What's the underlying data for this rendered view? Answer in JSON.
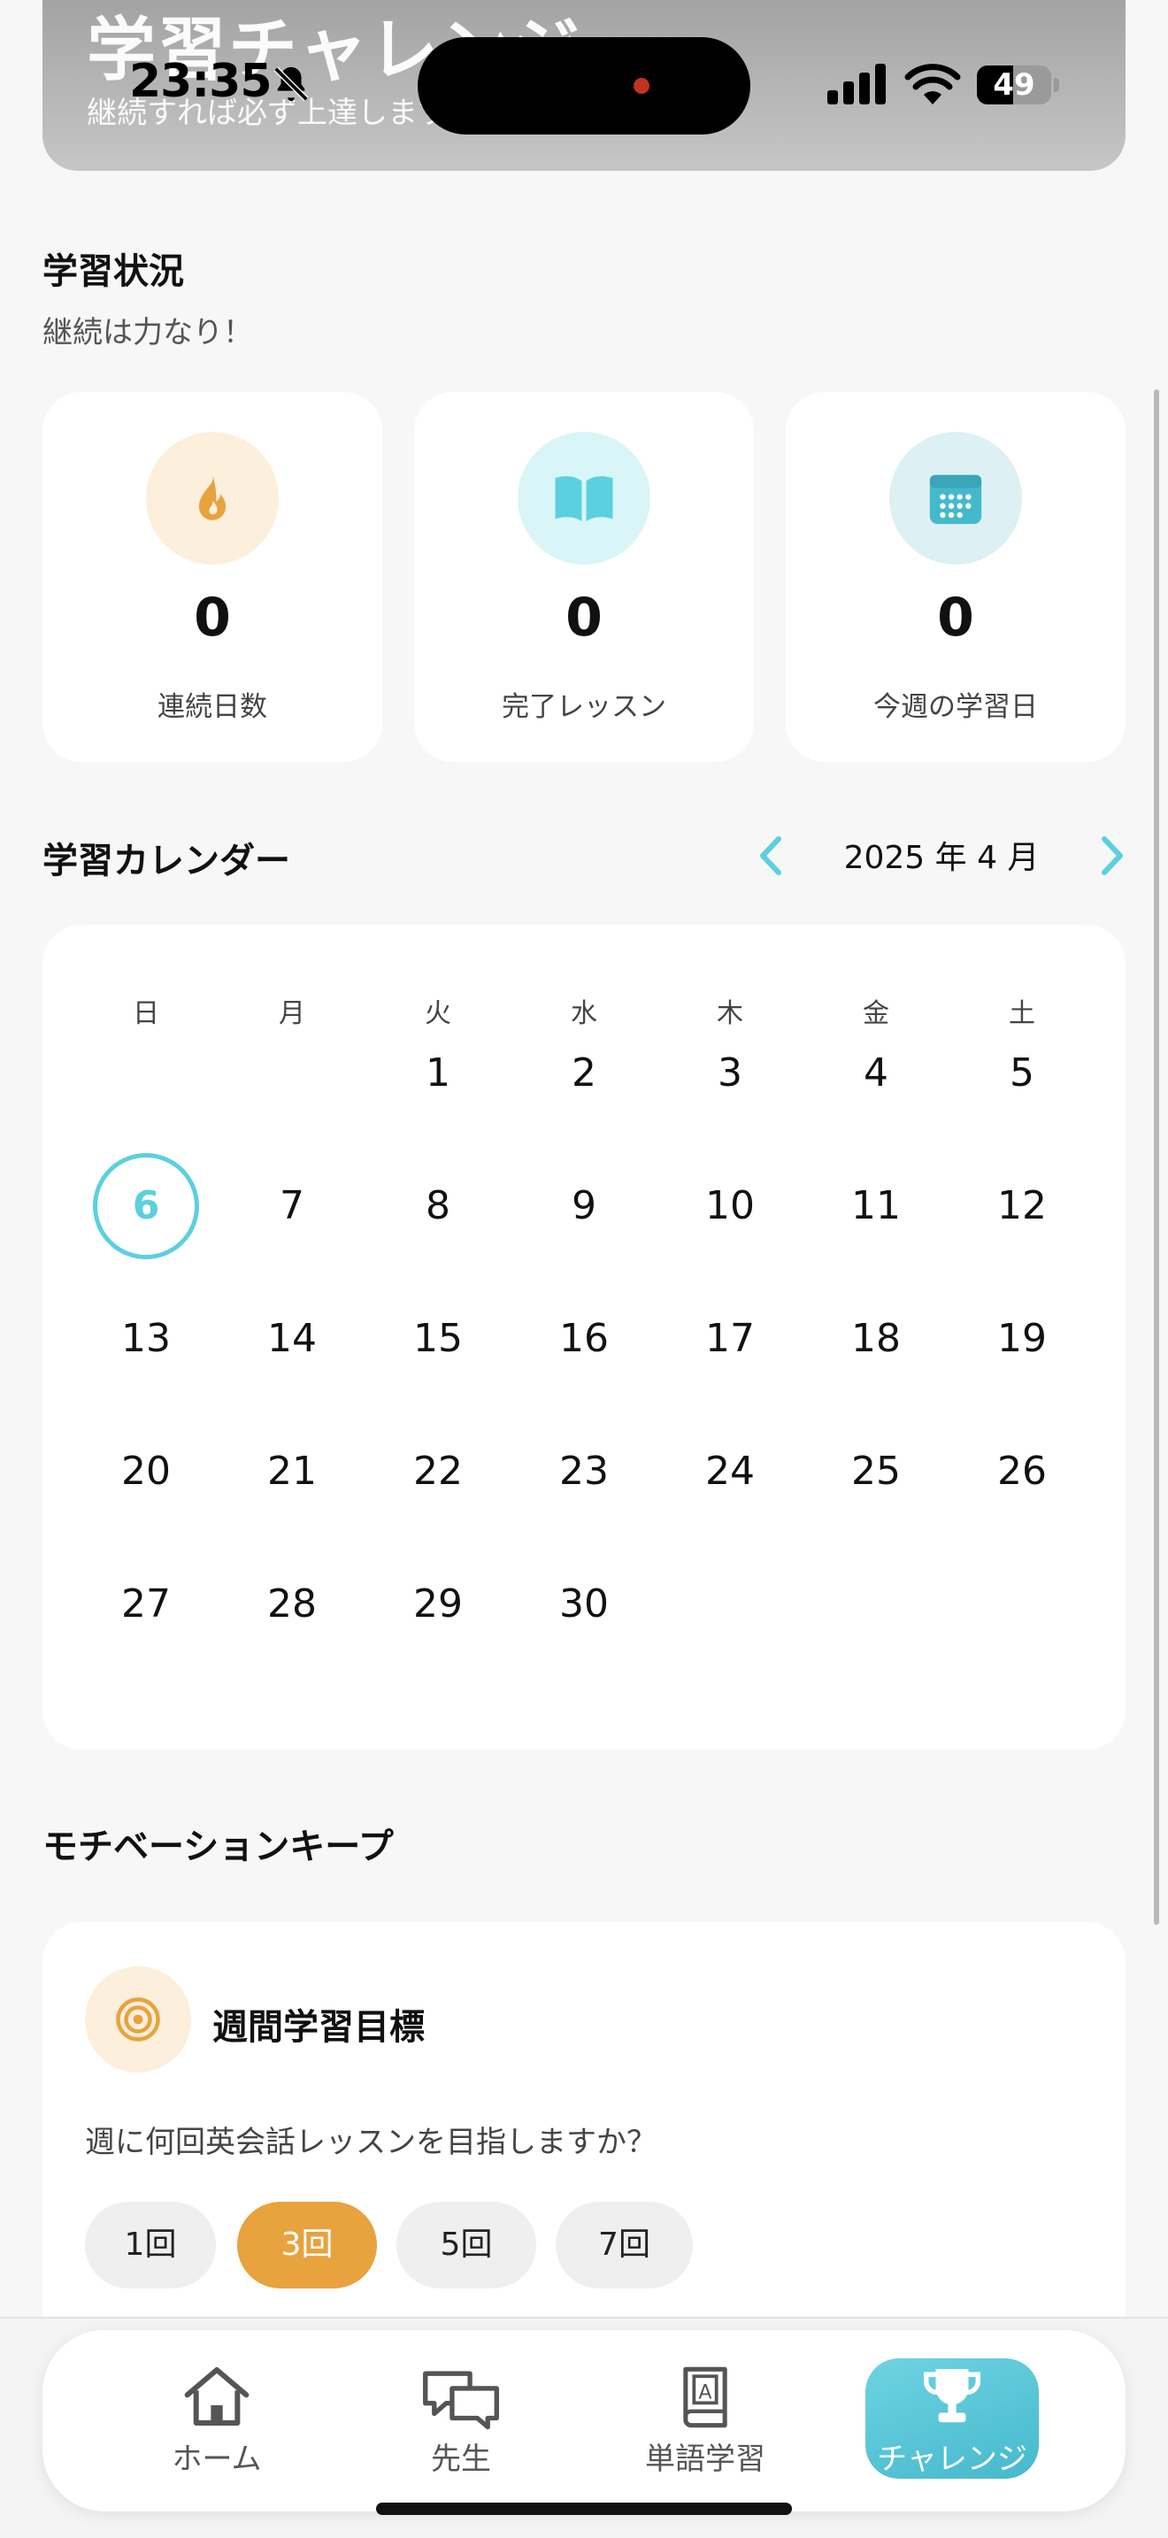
{
  "banner": {
    "title": "学習チャレンジ",
    "subtitle": "継続すれば必ず上達します"
  },
  "status_bar": {
    "time": "23:35",
    "battery_level": "49",
    "battery_fraction": 0.49,
    "icons": [
      "bell-slash-icon",
      "signal-icon",
      "wifi-icon",
      "battery-icon"
    ]
  },
  "study_status": {
    "title": "学習状況",
    "subtitle": "継続は力なり！",
    "stats": [
      {
        "value": "0",
        "label": "連続日数",
        "icon": "flame-icon",
        "icon_bg": "#fcefdc",
        "icon_color": "#e8a23e"
      },
      {
        "value": "0",
        "label": "完了レッスン",
        "icon": "book-icon",
        "icon_bg": "#d9f5f8",
        "icon_color": "#5bd0df"
      },
      {
        "value": "0",
        "label": "今週の学習日",
        "icon": "calendar-icon",
        "icon_bg": "#ddf0f4",
        "icon_color": "#45b9cc"
      }
    ]
  },
  "calendar": {
    "title": "学習カレンダー",
    "month_label": "2025 年 4 月",
    "weekdays": [
      "日",
      "月",
      "火",
      "水",
      "木",
      "金",
      "土"
    ],
    "weeks": [
      [
        "",
        "",
        "1",
        "2",
        "3",
        "4",
        "5"
      ],
      [
        "6",
        "7",
        "8",
        "9",
        "10",
        "11",
        "12"
      ],
      [
        "13",
        "14",
        "15",
        "16",
        "17",
        "18",
        "19"
      ],
      [
        "20",
        "21",
        "22",
        "23",
        "24",
        "25",
        "26"
      ],
      [
        "27",
        "28",
        "29",
        "30",
        "",
        "",
        ""
      ]
    ],
    "today": "6",
    "accent_color": "#5bd0df"
  },
  "motivation": {
    "title": "モチベーションキープ",
    "goal_title": "週間学習目標",
    "goal_question": "週に何回英会話レッスンを目指しますか？",
    "options": [
      "1回",
      "3回",
      "5回",
      "7回"
    ],
    "selected": "3回",
    "accent_color": "#e8a23e"
  },
  "tabbar": {
    "tabs": [
      {
        "label": "ホーム",
        "icon": "home-icon"
      },
      {
        "label": "先生",
        "icon": "chat-bubbles-icon"
      },
      {
        "label": "単語学習",
        "icon": "dictionary-icon"
      },
      {
        "label": "チャレンジ",
        "icon": "trophy-icon"
      }
    ],
    "active": "チャレンジ"
  }
}
